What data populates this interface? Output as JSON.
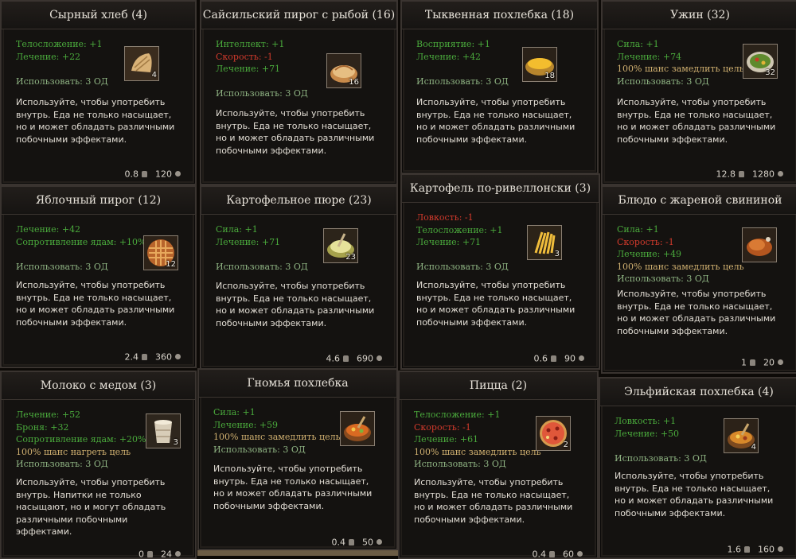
{
  "cards": [
    {
      "title": "Сырный хлеб (4)",
      "stats": [
        {
          "text": "Телосложение: +1",
          "tone": "good"
        },
        {
          "text": "Лечение: +22",
          "tone": "good"
        }
      ],
      "use": "Использовать: 3 ОД",
      "qty": "4",
      "icon": "bread-icon",
      "desc": "Используйте, чтобы употребить внутрь. Еда не только насыщает, но и может обладать различными побочными эффектами.",
      "weight": "0.8",
      "price": "120"
    },
    {
      "title": "Сайсильский пирог с рыбой (16)",
      "stats": [
        {
          "text": "Интеллект: +1",
          "tone": "good"
        },
        {
          "text": "Скорость: -1",
          "tone": "bad"
        },
        {
          "text": "Лечение: +71",
          "tone": "good"
        }
      ],
      "use": "Использовать: 3 ОД",
      "qty": "16",
      "icon": "fish-pie-icon",
      "desc": "Используйте, чтобы употребить внутрь. Еда не только насыщает, но и может обладать различными побочными эффектами.",
      "weight": "",
      "price": ""
    },
    {
      "title": "Тыквенная похлебка (18)",
      "stats": [
        {
          "text": "Восприятие: +1",
          "tone": "good"
        },
        {
          "text": "Лечение: +42",
          "tone": "good"
        }
      ],
      "use": "Использовать: 3 ОД",
      "qty": "18",
      "icon": "pumpkin-soup-icon",
      "desc": "Используйте, чтобы употребить внутрь. Еда не только насыщает, но и может обладать различными побочными эффектами.",
      "weight": "",
      "price": ""
    },
    {
      "title": "Ужин (32)",
      "stats": [
        {
          "text": "Сила: +1",
          "tone": "good"
        },
        {
          "text": "Лечение: +74",
          "tone": "good"
        },
        {
          "text": "100% шанс замедлить цель",
          "tone": "special"
        }
      ],
      "use": "Использовать: 3 ОД",
      "qty": "32",
      "icon": "dinner-salad-icon",
      "desc": "Используйте, чтобы употребить внутрь. Еда не только насыщает, но и может обладать различными побочными эффектами.",
      "weight": "12.8",
      "price": "1280"
    },
    {
      "title": "Яблочный пирог (12)",
      "stats": [
        {
          "text": "Лечение: +42",
          "tone": "good"
        },
        {
          "text": "Сопротивление ядам: +10%",
          "tone": "good"
        }
      ],
      "use": "Использовать: 3 ОД",
      "qty": "12",
      "icon": "apple-pie-icon",
      "desc": "Используйте, чтобы употребить внутрь. Еда не только насыщает, но и может обладать различными побочными эффектами.",
      "weight": "2.4",
      "price": "360"
    },
    {
      "title": "Картофельное пюре (23)",
      "stats": [
        {
          "text": "Сила: +1",
          "tone": "good"
        },
        {
          "text": "Лечение: +71",
          "tone": "good"
        }
      ],
      "use": "Использовать: 3 ОД",
      "qty": "23",
      "icon": "mashed-potato-icon",
      "desc": "Используйте, чтобы употребить внутрь. Еда не только насыщает, но и может обладать различными побочными эффектами.",
      "weight": "4.6",
      "price": "690"
    },
    {
      "title": "Картофель по-ривеллонски (3)",
      "stats": [
        {
          "text": "Ловкость: -1",
          "tone": "bad"
        },
        {
          "text": "Телосложение: +1",
          "tone": "good"
        },
        {
          "text": "Лечение: +71",
          "tone": "good"
        }
      ],
      "use": "Использовать: 3 ОД",
      "qty": "3",
      "icon": "fries-icon",
      "desc": "Используйте, чтобы употребить внутрь. Еда не только насыщает, но и может обладать различными побочными эффектами.",
      "weight": "0.6",
      "price": "90"
    },
    {
      "title": "Блюдо с жареной свининой",
      "stats": [
        {
          "text": "Сила: +1",
          "tone": "good"
        },
        {
          "text": "Скорость: -1",
          "tone": "bad"
        },
        {
          "text": "Лечение: +49",
          "tone": "good"
        },
        {
          "text": "100% шанс замедлить цель",
          "tone": "special"
        }
      ],
      "use": "Использовать: 3 ОД",
      "qty": "",
      "icon": "roast-pork-icon",
      "desc": "Используйте, чтобы употребить внутрь. Еда не только насыщает, но и может обладать различными побочными эффектами.",
      "weight": "1",
      "price": "20"
    },
    {
      "title": "Молоко с медом (3)",
      "stats": [
        {
          "text": "Лечение: +52",
          "tone": "good"
        },
        {
          "text": "Броня: +32",
          "tone": "good"
        },
        {
          "text": "Сопротивление ядам: +20%",
          "tone": "good"
        },
        {
          "text": "100% шанс нагреть цель",
          "tone": "special"
        }
      ],
      "use": "Использовать: 3 ОД",
      "qty": "3",
      "icon": "milk-honey-icon",
      "desc": "Используйте, чтобы употребить внутрь. Напитки не только насыщают, но и могут обладать различными побочными эффектами.",
      "weight": "0",
      "price": "24"
    },
    {
      "title": "Гномья похлебка",
      "stats": [
        {
          "text": "Сила: +1",
          "tone": "good"
        },
        {
          "text": "Лечение: +59",
          "tone": "good"
        },
        {
          "text": "100% шанс замедлить цель",
          "tone": "special"
        }
      ],
      "use": "Использовать: 3 ОД",
      "qty": "",
      "icon": "dwarf-stew-icon",
      "desc": "Используйте, чтобы употребить внутрь. Еда не только насыщает, но и может обладать различными побочными эффектами.",
      "weight": "0.4",
      "price": "50"
    },
    {
      "title": "Пицца (2)",
      "stats": [
        {
          "text": "Телосложение: +1",
          "tone": "good"
        },
        {
          "text": "Скорость: -1",
          "tone": "bad"
        },
        {
          "text": "Лечение: +61",
          "tone": "good"
        },
        {
          "text": "100% шанс замедлить цель",
          "tone": "special"
        }
      ],
      "use": "Использовать: 3 ОД",
      "qty": "2",
      "icon": "pizza-icon",
      "desc": "Используйте, чтобы употребить внутрь. Еда не только насыщает, но и может обладать различными побочными эффектами.",
      "weight": "0.4",
      "price": "60"
    },
    {
      "title": "Эльфийская похлебка (4)",
      "stats": [
        {
          "text": "Ловкость: +1",
          "tone": "good"
        },
        {
          "text": "Лечение: +50",
          "tone": "good"
        }
      ],
      "use": "Использовать: 3 ОД",
      "qty": "4",
      "icon": "elf-stew-icon",
      "desc": "Используйте, чтобы употребить внутрь. Еда не только насыщает, но и может обладать различными побочными эффектами.",
      "weight": "1.6",
      "price": "160"
    }
  ]
}
